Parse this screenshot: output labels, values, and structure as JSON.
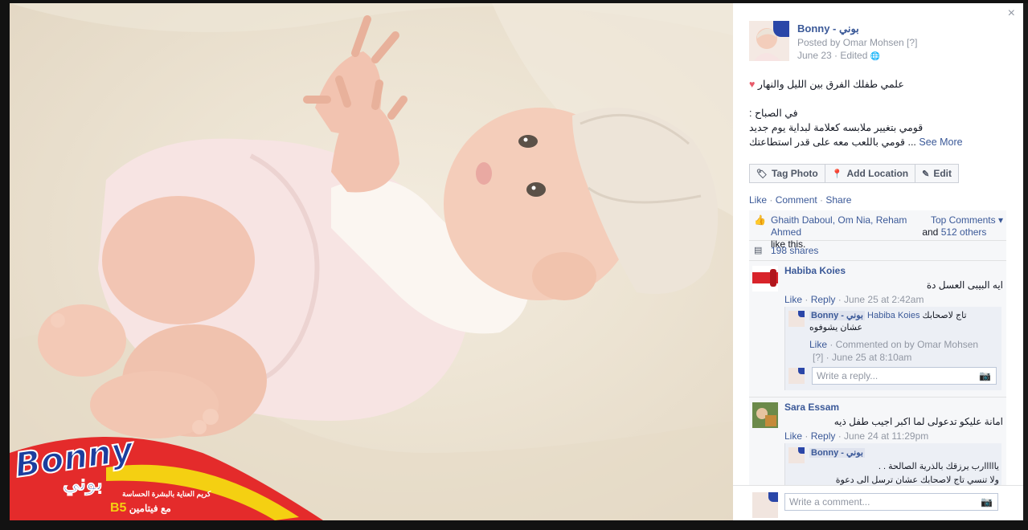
{
  "photo": {
    "brand": {
      "logo_text": "Bonny",
      "logo_arabic": "بوني",
      "line1": "كريم العناية بالبشرة الحساسة",
      "line2": "مع فيتامين",
      "vitamin": "B5"
    }
  },
  "panel": {
    "close_label": "×",
    "page_name": "Bonny - بوني",
    "posted_by": "Posted by Omar Mohsen [?]",
    "date": "June 23 · Edited ",
    "globe": "🌐",
    "caption_line1": "علمي طفلك الفرق بين الليل والنهار",
    "heart": "♥",
    "caption_line2": "في الصباح :",
    "caption_line3": "قومي بتغيير ملابسه كعلامة لبداية يوم جديد",
    "caption_line4": "قومي باللعب معه على قدر استطاعتك ...",
    "see_more": "See More",
    "actions": {
      "tag": "Tag Photo",
      "location": "Add Location",
      "edit": "Edit"
    },
    "like": "Like",
    "comment": "Comment",
    "share": "Share",
    "likes_names": "Ghaith Daboul, Om Nia, Reham Ahmed",
    "likes_and": " and ",
    "likes_others": "512 others",
    "likes_tail": " like this.",
    "top_comments": "Top Comments ▾",
    "shares": "198 shares",
    "comments": [
      {
        "name": "Habiba Koies",
        "text": "ايه البيبى العسل دة",
        "like": "Like",
        "reply": "Reply",
        "time": "June 25 at 2:42am"
      },
      {
        "name": "Sara Essam",
        "text": "امانة عليكو تدعولى لما اكبر اجيب طفل ذيه",
        "like": "Like",
        "reply": "Reply",
        "time": "June 24 at 11:29pm"
      }
    ],
    "reply1": {
      "name": "Bonny - بوني",
      "mention": "Habiba Koies",
      "text1": "تاج لاصحابك",
      "text2": "عشان يشوفوه",
      "like": "Like",
      "meta1": " · Commented on by Omar Mohsen",
      "meta2": "[?] · June 25 at 8:10am"
    },
    "reply_placeholder": "Write a reply...",
    "reply2": {
      "name": "Bonny - بوني",
      "text1": "يااااارب يرزقك بالذرية الصالحة . .",
      "text2": "ولا تنسي تاج لاصحابك عشان ترسل الى دعوة"
    },
    "comment_placeholder": "Write a comment...",
    "camera": "📷",
    "sep": " · "
  }
}
